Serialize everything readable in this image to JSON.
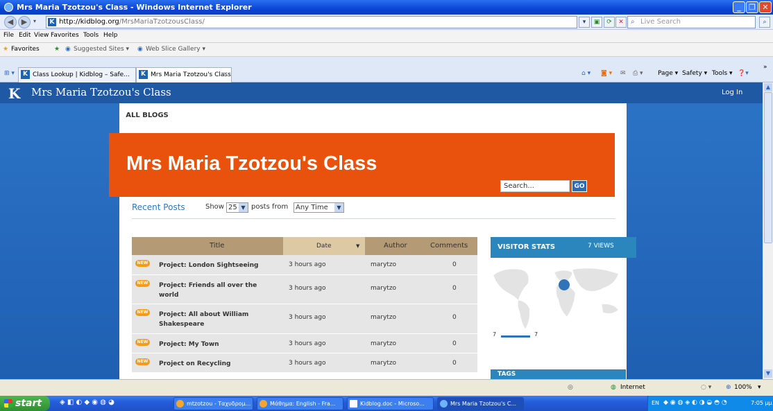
{
  "window": {
    "title": "Mrs Maria Tzotzou's Class - Windows Internet Explorer"
  },
  "address": {
    "url_host": "http://kidblog.org",
    "url_path": "/MrsMariaTzotzousClass/",
    "search_placeholder": "Live Search"
  },
  "menu": [
    "File",
    "Edit",
    "View",
    "Favorites",
    "Tools",
    "Help"
  ],
  "favorites": {
    "label": "Favorites",
    "suggested": "Suggested Sites ▾",
    "webslice": "Web Slice Gallery ▾"
  },
  "tabs": [
    {
      "label": "Class Lookup | Kidblog – Safe..."
    },
    {
      "label": "Mrs Maria Tzotzou's Class"
    }
  ],
  "command_bar": {
    "page": "Page ▾",
    "safety": "Safety ▾",
    "tools": "Tools ▾"
  },
  "site": {
    "logo": "K",
    "title": "Mrs Maria Tzotzou's Class",
    "login": "Log In"
  },
  "nav": {
    "all_blogs": "ALL BLOGS"
  },
  "banner": {
    "title": "Mrs Maria Tzotzou's Class",
    "search_value": "Search...",
    "go": "GO"
  },
  "recent": {
    "heading": "Recent Posts",
    "show": "Show",
    "count": "25",
    "posts_from": "posts from",
    "time": "Any Time"
  },
  "table": {
    "headers": {
      "title": "Title",
      "date": "Date",
      "author": "Author",
      "comments": "Comments"
    },
    "new_badge": "NEW",
    "rows": [
      {
        "title": "Project: London Sightseeing",
        "date": "3 hours ago",
        "author": "marytzo",
        "comments": "0"
      },
      {
        "title": "Project: Friends all over the world",
        "date": "3 hours ago",
        "author": "marytzo",
        "comments": "0"
      },
      {
        "title": "Project: All about William Shakespeare",
        "date": "3 hours ago",
        "author": "marytzo",
        "comments": "0"
      },
      {
        "title": "Project: My Town",
        "date": "3 hours ago",
        "author": "marytzo",
        "comments": "0"
      },
      {
        "title": "Project on Recycling",
        "date": "3 hours ago",
        "author": "marytzo",
        "comments": "0"
      }
    ]
  },
  "visitor_stats": {
    "heading": "VISITOR STATS",
    "views": "7 VIEWS",
    "bar_left": "7",
    "bar_right": "7"
  },
  "tags": {
    "heading": "TAGS"
  },
  "statusbar": {
    "zone": "Internet",
    "zoom": "100%"
  },
  "taskbar": {
    "start": "start",
    "items": [
      "mtzotzou - Ταχυδρομ...",
      "Μάθημα: English - Fra...",
      "Kidblog.doc - Microso...",
      "Mrs Maria Tzotzou's C..."
    ],
    "lang": "EN",
    "clock": "7:05 μμ"
  },
  "colors": {
    "banner": "#e8520c",
    "page_bg": "#2c74c7",
    "table_header": "#b49a75",
    "stats": "#2a86bd"
  }
}
